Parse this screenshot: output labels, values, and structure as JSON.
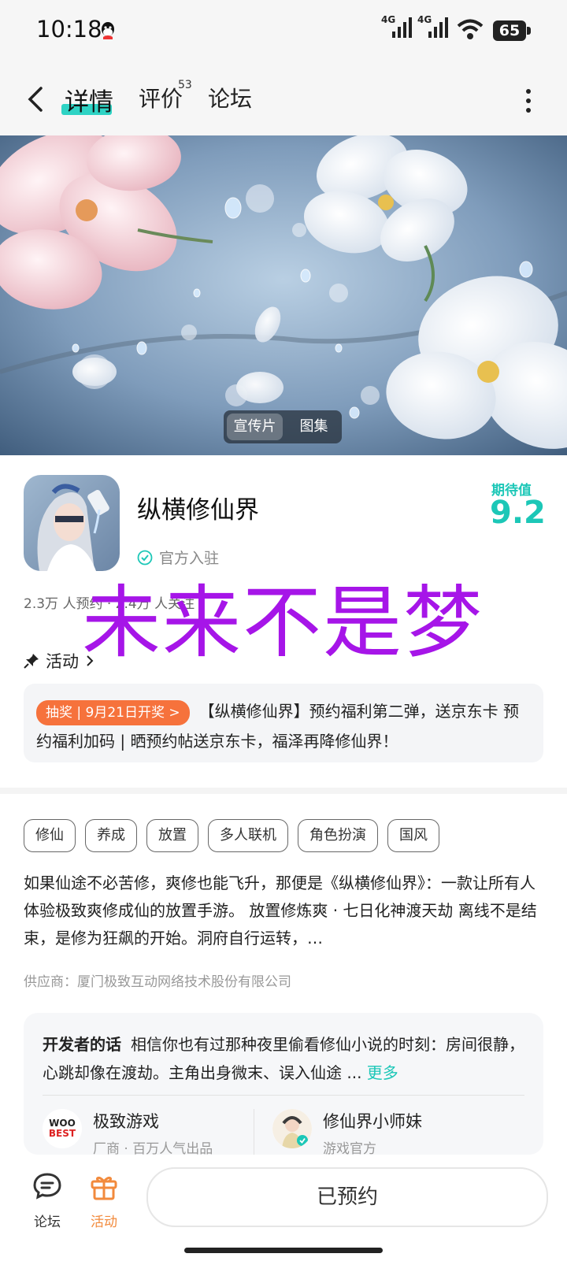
{
  "status": {
    "time": "10:18",
    "network1": "4G",
    "network2": "4G",
    "battery": "65"
  },
  "nav": {
    "tabs": [
      "详情",
      "评价",
      "论坛"
    ],
    "review_count": "53"
  },
  "hero": {
    "toggle": [
      "宣传片",
      "图集"
    ]
  },
  "game": {
    "name": "纵横修仙界",
    "official": "官方入驻",
    "rating_label": "期待值",
    "rating": "9.2",
    "stats": "2.3万 人预约 · 2.4万 人关注"
  },
  "overlay": "未来不是梦",
  "activity": {
    "label": "活动",
    "badge": "抽奖 | 9月21日开奖 >",
    "text": "【纵横修仙界】预约福利第二弹，送京东卡 预约福利加码 | 晒预约帖送京东卡，福泽再降修仙界！"
  },
  "tags": [
    "修仙",
    "养成",
    "放置",
    "多人联机",
    "角色扮演",
    "国风"
  ],
  "description": "如果仙途不必苦修，爽修也能飞升，那便是《纵横修仙界》：一款让所有人体验极致爽修成仙的放置手游。 放置修炼爽 · 七日化神渡天劫 离线不是结束，是修为狂飙的开始。洞府自行运转，…",
  "supplier": "供应商：厦门极致互动网络技术股份有限公司",
  "developer": {
    "title": "开发者的话",
    "text": "相信你也有过那种夜里偷看修仙小说的时刻：房间很静，心跳却像在渡劫。主角出身微末、误入仙途 ...",
    "more": "更多",
    "accounts": [
      {
        "name": "极致游戏",
        "sub": "厂商 · 百万人气出品"
      },
      {
        "name": "修仙界小师妹",
        "sub": "游戏官方"
      }
    ]
  },
  "bottom": {
    "forum": "论坛",
    "activity": "活动",
    "reserve": "已预约"
  },
  "colors": {
    "accent": "#1cc7b7",
    "overlay": "#a615e8",
    "lottery": "#f6723c",
    "activity_tab": "#f28a3c"
  }
}
